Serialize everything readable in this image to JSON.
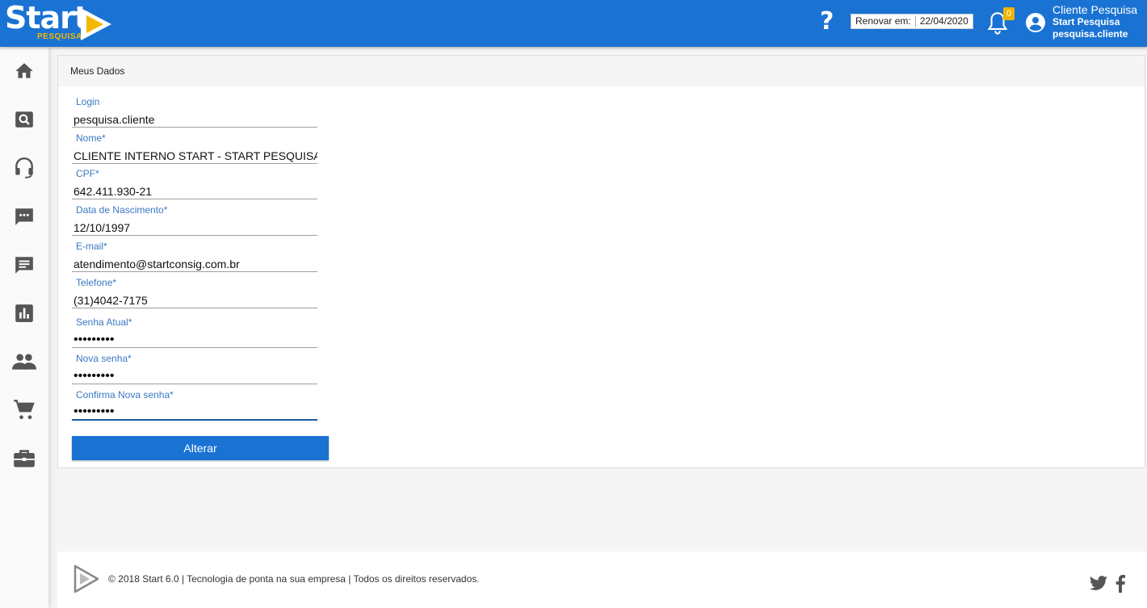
{
  "header": {
    "logo_text": "Start",
    "logo_sub": "PESQUISA",
    "help_label": "?",
    "renew_label": "Renovar em:",
    "renew_date": "22/04/2020",
    "notifications_count": "0",
    "user_name": "Cliente Pesquisa",
    "user_company": "Start Pesquisa",
    "user_login": "pesquisa.cliente"
  },
  "sidebar": {
    "items": [
      {
        "icon": "home-icon"
      },
      {
        "icon": "search-icon"
      },
      {
        "icon": "headset-icon"
      },
      {
        "icon": "chat-icon"
      },
      {
        "icon": "message-icon"
      },
      {
        "icon": "bar-chart-icon"
      },
      {
        "icon": "people-icon"
      },
      {
        "icon": "cart-icon"
      },
      {
        "icon": "briefcase-icon"
      }
    ]
  },
  "panel": {
    "title": "Meus Dados",
    "fields": [
      {
        "label": "Login",
        "value": "pesquisa.cliente"
      },
      {
        "label": "Nome*",
        "value": "CLIENTE INTERNO START - START PESQUISA"
      },
      {
        "label": "CPF*",
        "value": "642.411.930-21"
      },
      {
        "label": "Data de Nascimento*",
        "value": "12/10/1997"
      },
      {
        "label": "E-mail*",
        "value": "atendimento@startconsig.com.br"
      },
      {
        "label": "Telefone*",
        "value": "(31)4042-7175"
      },
      {
        "label": "Senha Atual*",
        "value": "•••••••••"
      },
      {
        "label": "Nova senha*",
        "value": "•••••••••"
      },
      {
        "label": "Confirma Nova senha*",
        "value": "•••••••••"
      }
    ],
    "submit_label": "Alterar"
  },
  "footer": {
    "text": "© 2018 Start 6.0 | Tecnologia de ponta na sua empresa | Todos os direitos reservados.",
    "social": [
      "twitter-icon",
      "facebook-icon"
    ]
  },
  "colors": {
    "primary": "#1a73d3",
    "accent": "#f5b800",
    "label": "#3a78c4"
  }
}
